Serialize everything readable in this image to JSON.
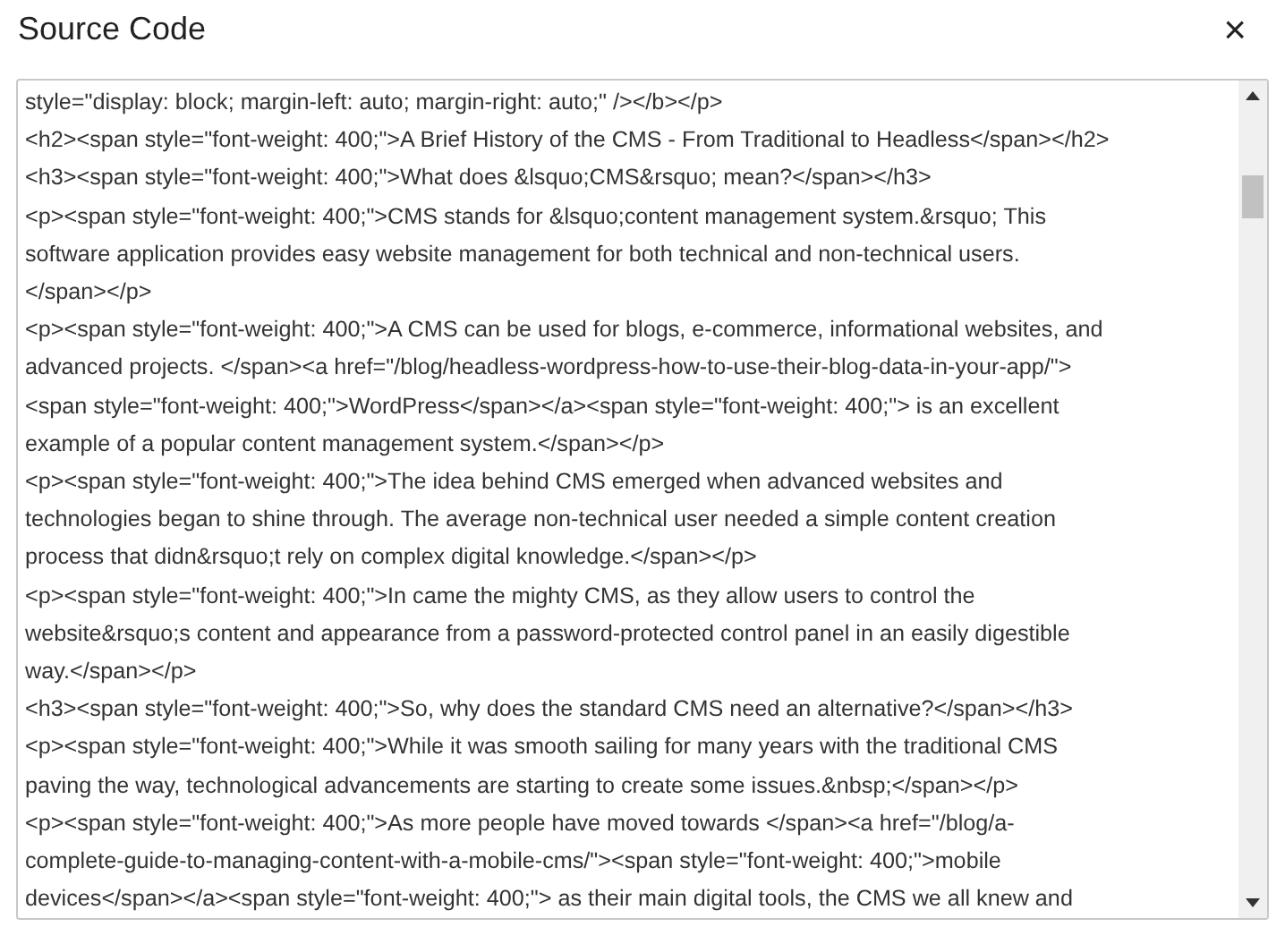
{
  "dialog": {
    "title": "Source Code",
    "close": "×"
  },
  "source_lines": [
    "style=\"display: block; margin-left: auto; margin-right: auto;\" /></b></p>",
    "<h2><span style=\"font-weight: 400;\">A Brief History of the CMS - From Traditional to Headless</span></h2>",
    "<h3><span style=\"font-weight: 400;\">What does &lsquo;CMS&rsquo; mean?</span></h3>",
    "<p><span style=\"font-weight: 400;\">CMS stands for &lsquo;content management system.&rsquo; This",
    "software application provides easy website management for both technical and non-technical users.",
    "</span></p>",
    "<p><span style=\"font-weight: 400;\">A CMS can be used for blogs, e-commerce, informational websites, and",
    "advanced projects. </span><a href=\"/blog/headless-wordpress-how-to-use-their-blog-data-in-your-app/\">",
    "<span style=\"font-weight: 400;\">WordPress</span></a><span style=\"font-weight: 400;\"> is an excellent",
    "example of a popular content management system.</span></p>",
    "<p><span style=\"font-weight: 400;\">The idea behind CMS emerged when advanced websites and",
    "technologies began to shine through. The average non-technical user needed a simple content creation",
    "process that didn&rsquo;t rely on complex digital knowledge.</span></p>",
    "<p><span style=\"font-weight: 400;\">In came the mighty CMS, as they allow users to control the",
    "website&rsquo;s content and appearance from a password-protected control panel in an easily digestible",
    "way.</span></p>",
    "<h3><span style=\"font-weight: 400;\">So, why does the standard CMS need an alternative?</span></h3>",
    "<p><span style=\"font-weight: 400;\">While it was smooth sailing for many years with the traditional CMS",
    "paving the way, technological advancements are starting to create some issues.&nbsp;</span></p>",
    "<p><span style=\"font-weight: 400;\">As more people have moved towards </span><a href=\"/blog/a-",
    "complete-guide-to-managing-content-with-a-mobile-cms/\"><span style=\"font-weight: 400;\">mobile",
    "devices</span></a><span style=\"font-weight: 400;\"> as their main digital tools, the CMS we all knew and"
  ]
}
